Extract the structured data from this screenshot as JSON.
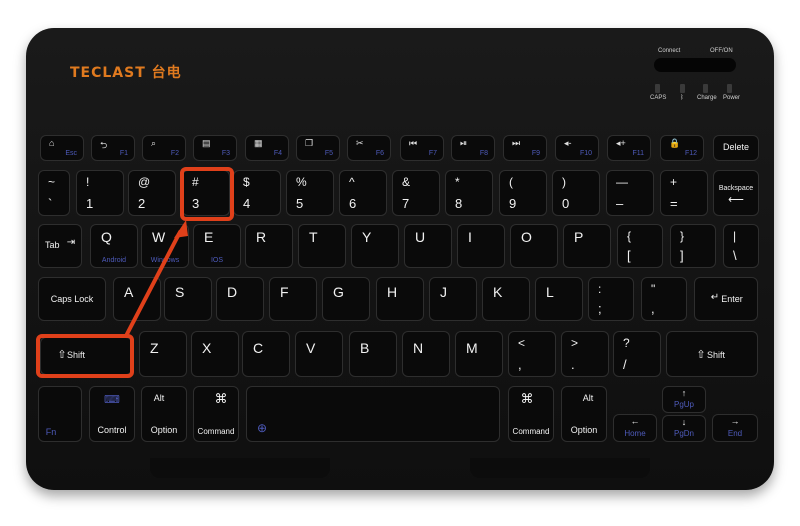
{
  "brand": {
    "logo_text": "TECLAST 台电",
    "accent": "#e07a1f"
  },
  "status": {
    "connect": "Connect",
    "off_on": "OFF/ON",
    "leds": [
      "CAPS",
      "ᛒ",
      "Charge",
      "Power"
    ]
  },
  "fn_row": [
    {
      "icon": "home-icon",
      "fn": "Esc"
    },
    {
      "icon": "back-icon",
      "fn": "F1"
    },
    {
      "icon": "search-icon",
      "fn": "F2"
    },
    {
      "icon": "document-icon",
      "fn": "F3"
    },
    {
      "icon": "screenshot-icon",
      "fn": "F4"
    },
    {
      "icon": "copy-icon",
      "fn": "F5"
    },
    {
      "icon": "cut-icon",
      "fn": "F6"
    },
    {
      "icon": "previous-track-icon",
      "fn": "F7"
    },
    {
      "icon": "play-pause-icon",
      "fn": "F8"
    },
    {
      "icon": "next-track-icon",
      "fn": "F9"
    },
    {
      "icon": "volume-down-icon",
      "fn": "F10"
    },
    {
      "icon": "volume-up-icon",
      "fn": "F11"
    },
    {
      "icon": "lock-icon",
      "fn": "F12"
    },
    {
      "icon": "",
      "fn": "Delete"
    }
  ],
  "num_row": [
    {
      "top": "~",
      "bot": "`"
    },
    {
      "top": "!",
      "bot": "1"
    },
    {
      "top": "@",
      "bot": "2"
    },
    {
      "top": "#",
      "bot": "3"
    },
    {
      "top": "$",
      "bot": "4"
    },
    {
      "top": "%",
      "bot": "5"
    },
    {
      "top": "^",
      "bot": "6"
    },
    {
      "top": "&",
      "bot": "7"
    },
    {
      "top": "*",
      "bot": "8"
    },
    {
      "top": "(",
      "bot": "9"
    },
    {
      "top": ")",
      "bot": "0"
    },
    {
      "top": "—",
      "bot": "–"
    },
    {
      "top": "+",
      "bot": "="
    },
    {
      "top": "Backspace",
      "bot": "⟵"
    }
  ],
  "qwerty_row": {
    "tab": "Tab",
    "keys": [
      {
        "main": "Q",
        "sub": "Android"
      },
      {
        "main": "W",
        "sub": "Windows"
      },
      {
        "main": "E",
        "sub": "IOS"
      },
      {
        "main": "R",
        "sub": ""
      },
      {
        "main": "T",
        "sub": ""
      },
      {
        "main": "Y",
        "sub": ""
      },
      {
        "main": "U",
        "sub": ""
      },
      {
        "main": "I",
        "sub": ""
      },
      {
        "main": "O",
        "sub": ""
      },
      {
        "main": "P",
        "sub": ""
      }
    ],
    "brackets": [
      {
        "top": "{",
        "bot": "["
      },
      {
        "top": "}",
        "bot": "]"
      },
      {
        "top": "|",
        "bot": "\\"
      }
    ]
  },
  "home_row": {
    "caps": "Caps Lock",
    "keys": [
      "A",
      "S",
      "D",
      "F",
      "G",
      "H",
      "J",
      "K",
      "L"
    ],
    "punct": [
      {
        "top": ":",
        "bot": ";"
      },
      {
        "top": "\"",
        "bot": ","
      }
    ],
    "enter": "Enter"
  },
  "shift_row": {
    "left_shift": "Shift",
    "keys": [
      "Z",
      "X",
      "C",
      "V",
      "B",
      "N",
      "M"
    ],
    "punct": [
      {
        "top": "<",
        "bot": ","
      },
      {
        "top": ">",
        "bot": "."
      },
      {
        "top": "?",
        "bot": "/"
      }
    ],
    "right_shift": "Shift"
  },
  "bottom_row": {
    "fn": "Fn",
    "control": "Control",
    "alt": "Alt",
    "option": "Option",
    "command_symbol": "⌘",
    "command": "Command",
    "pgup": "PgUp",
    "pgdn": "PgDn",
    "home": "Home",
    "end": "End"
  },
  "annotation": {
    "color": "#e0401a"
  }
}
